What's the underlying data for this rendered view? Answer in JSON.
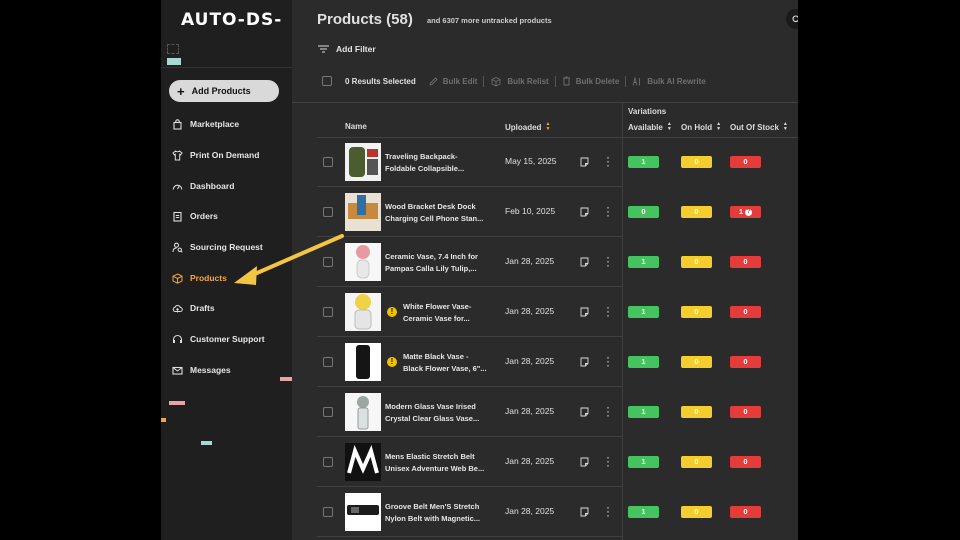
{
  "sidebar": {
    "logo": "AUTO-DS-",
    "add_button": "Add Products",
    "items": [
      {
        "label": "Marketplace",
        "icon": "bag-icon"
      },
      {
        "label": "Print On Demand",
        "icon": "shirt-icon"
      },
      {
        "label": "Dashboard",
        "icon": "gauge-icon"
      },
      {
        "label": "Orders",
        "icon": "clipboard-icon"
      },
      {
        "label": "Sourcing Request",
        "icon": "person-search-icon"
      },
      {
        "label": "Products",
        "icon": "box-icon",
        "active": true
      },
      {
        "label": "Drafts",
        "icon": "cloud-icon"
      },
      {
        "label": "Customer Support",
        "icon": "headset-icon"
      },
      {
        "label": "Messages",
        "icon": "mail-icon"
      }
    ]
  },
  "header": {
    "title": "Products (58)",
    "subtitle": "and 6307 more untracked products",
    "add_filter": "Add Filter"
  },
  "bulkbar": {
    "selected": "0 Results Selected",
    "bulk_edit": "Bulk Edit",
    "bulk_relist": "Bulk Relist",
    "bulk_delete": "Bulk Delete",
    "bulk_ai_rewrite": "Bulk AI Rewrite"
  },
  "table": {
    "col_name": "Name",
    "col_uploaded": "Uploaded",
    "col_variations": "Variations",
    "col_available": "Available",
    "col_on_hold": "On Hold",
    "col_out_of_stock": "Out Of Stock",
    "rows": [
      {
        "name": "Traveling Backpack-\nFoldable Collapsible...",
        "uploaded": "May 15, 2025",
        "available": "1",
        "on_hold": "0",
        "out_of_stock": "0",
        "warning": false
      },
      {
        "name": "Wood Bracket Desk Dock\nCharging Cell Phone Stan...",
        "uploaded": "Feb 10, 2025",
        "available": "0",
        "on_hold": "0",
        "out_of_stock": "1",
        "warning": false,
        "oos_help": true
      },
      {
        "name": "Ceramic Vase, 7.4 Inch for\nPampas Calla Lily Tulip,...",
        "uploaded": "Jan 28, 2025",
        "available": "1",
        "on_hold": "0",
        "out_of_stock": "0",
        "warning": false
      },
      {
        "name": "White Flower Vase-\nCeramic Vase for...",
        "uploaded": "Jan 28, 2025",
        "available": "1",
        "on_hold": "0",
        "out_of_stock": "0",
        "warning": true
      },
      {
        "name": "Matte Black Vase -\nBlack Flower Vase, 6\"...",
        "uploaded": "Jan 28, 2025",
        "available": "1",
        "on_hold": "0",
        "out_of_stock": "0",
        "warning": true
      },
      {
        "name": "Modern Glass Vase Irised\nCrystal Clear Glass Vase...",
        "uploaded": "Jan 28, 2025",
        "available": "1",
        "on_hold": "0",
        "out_of_stock": "0",
        "warning": false
      },
      {
        "name": "Mens Elastic Stretch Belt\nUnisex Adventure Web Be...",
        "uploaded": "Jan 28, 2025",
        "available": "1",
        "on_hold": "0",
        "out_of_stock": "0",
        "warning": false
      },
      {
        "name": "Groove Belt Men'S Stretch\nNylon Belt with Magnetic...",
        "uploaded": "Jan 28, 2025",
        "available": "1",
        "on_hold": "0",
        "out_of_stock": "0",
        "warning": false
      }
    ]
  },
  "colors": {
    "accent": "#f3a63a",
    "available": "#45c35f",
    "on_hold": "#f6cd2e",
    "out_of_stock": "#e43b3b",
    "annotation_arrow": "#f4c542"
  }
}
